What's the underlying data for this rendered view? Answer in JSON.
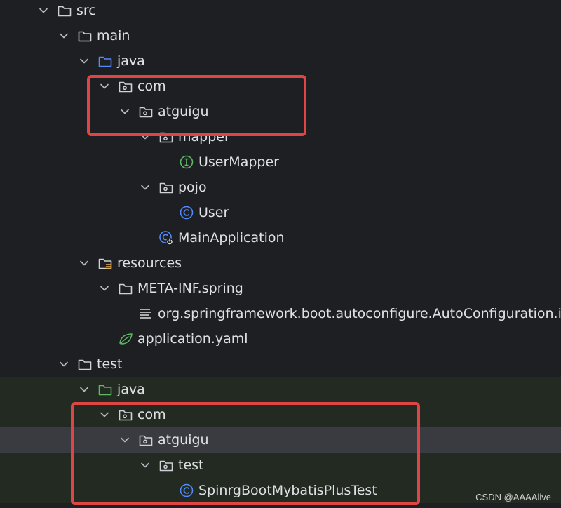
{
  "colors": {
    "background": "#1e1f22",
    "test_background": "#222a21",
    "selected_background": "#393b40",
    "text": "#dfe1e5",
    "folder": "#cfd1d6",
    "source_folder": "#548af7",
    "test_folder": "#5fb865",
    "interface": "#5fb865",
    "class": "#548af7",
    "highlight": "#e04545"
  },
  "tree": {
    "rows": [
      {
        "id": "src",
        "label": "src",
        "depth": 1,
        "expanded": true,
        "icon": "folder-icon"
      },
      {
        "id": "main",
        "label": "main",
        "depth": 2,
        "expanded": true,
        "icon": "folder-icon"
      },
      {
        "id": "java-main",
        "label": "java",
        "depth": 3,
        "expanded": true,
        "icon": "source-folder-icon"
      },
      {
        "id": "com-main",
        "label": "com",
        "depth": 4,
        "expanded": true,
        "icon": "package-icon"
      },
      {
        "id": "atguigu-main",
        "label": "atguigu",
        "depth": 5,
        "expanded": true,
        "icon": "package-icon"
      },
      {
        "id": "mapper",
        "label": "mapper",
        "depth": 6,
        "expanded": true,
        "icon": "package-icon"
      },
      {
        "id": "usermapper",
        "label": "UserMapper",
        "depth": 7,
        "icon": "interface-icon"
      },
      {
        "id": "pojo",
        "label": "pojo",
        "depth": 6,
        "expanded": true,
        "icon": "package-icon"
      },
      {
        "id": "user",
        "label": "User",
        "depth": 7,
        "icon": "class-icon"
      },
      {
        "id": "mainapplication",
        "label": "MainApplication",
        "depth": 6,
        "icon": "spring-boot-class-icon"
      },
      {
        "id": "resources",
        "label": "resources",
        "depth": 3,
        "expanded": true,
        "icon": "resources-folder-icon"
      },
      {
        "id": "meta-inf",
        "label": "META-INF.spring",
        "depth": 4,
        "expanded": true,
        "icon": "folder-icon"
      },
      {
        "id": "autoconfig-imports",
        "label": "org.springframework.boot.autoconfigure.AutoConfiguration.imports",
        "depth": 5,
        "icon": "text-file-icon"
      },
      {
        "id": "application-yaml",
        "label": "application.yaml",
        "depth": 4,
        "icon": "spring-yaml-icon"
      },
      {
        "id": "test",
        "label": "test",
        "depth": 2,
        "expanded": true,
        "icon": "folder-icon"
      },
      {
        "id": "java-test",
        "label": "java",
        "depth": 3,
        "expanded": true,
        "icon": "test-folder-icon",
        "test_bg": true
      },
      {
        "id": "com-test",
        "label": "com",
        "depth": 4,
        "expanded": true,
        "icon": "package-icon",
        "test_bg": true
      },
      {
        "id": "atguigu-test",
        "label": "atguigu",
        "depth": 5,
        "expanded": true,
        "icon": "package-icon",
        "test_bg": true,
        "selected": true
      },
      {
        "id": "test-pkg",
        "label": "test",
        "depth": 6,
        "expanded": true,
        "icon": "package-icon",
        "test_bg": true
      },
      {
        "id": "test-class",
        "label": "SpinrgBootMybatisPlusTest",
        "depth": 7,
        "icon": "class-icon",
        "test_bg": true
      }
    ]
  },
  "watermark": "CSDN @AAAAlive"
}
